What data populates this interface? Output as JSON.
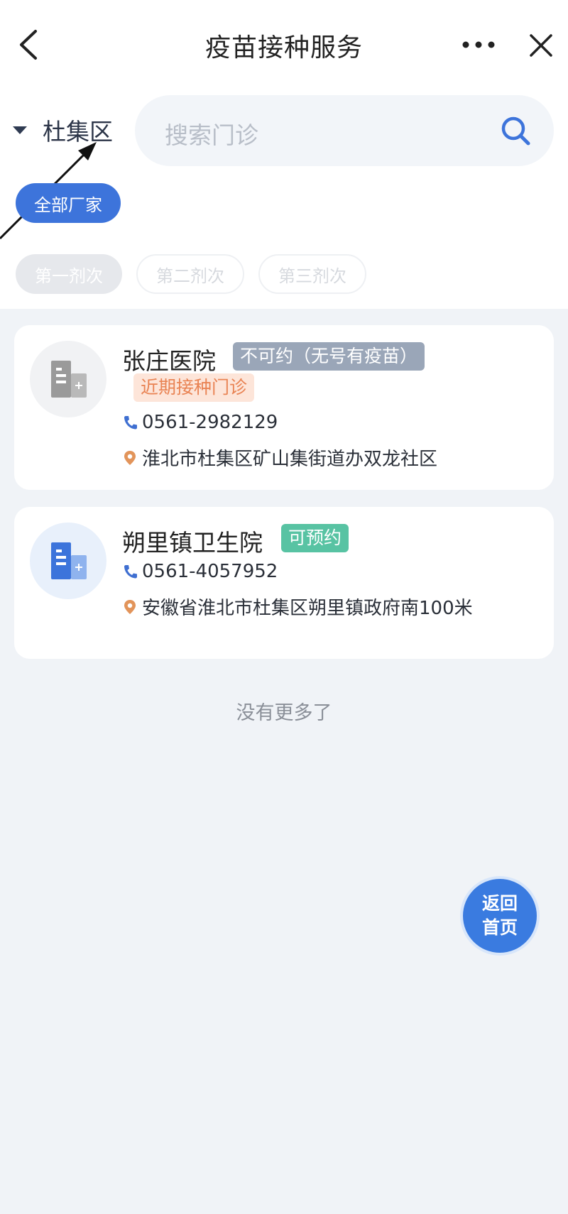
{
  "header": {
    "title": "疫苗接种服务"
  },
  "filters": {
    "district": "杜集区",
    "search_placeholder": "搜索门诊",
    "manufacturer_chip": "全部厂家",
    "dose_chips": [
      "第一剂次",
      "第二剂次",
      "第三剂次"
    ]
  },
  "clinics": [
    {
      "name": "张庄医院",
      "status": "不可约（无号有疫苗）",
      "extra_tag": "近期接种门诊",
      "phone": "0561-2982129",
      "address": "淮北市杜集区矿山集街道办双龙社区",
      "status_color": "#9aa6b8"
    },
    {
      "name": "朔里镇卫生院",
      "status": "可预约",
      "phone": "0561-4057952",
      "address": "安徽省淮北市杜集区朔里镇政府南100米",
      "status_color": "#58c3a3"
    }
  ],
  "list_end_text": "没有更多了",
  "fab": {
    "line1": "返回",
    "line2": "首页"
  },
  "colors": {
    "accent": "#3d74db",
    "background": "#f0f3f7",
    "phone_icon": "#3f6fd1",
    "location_icon": "#e2945a"
  }
}
